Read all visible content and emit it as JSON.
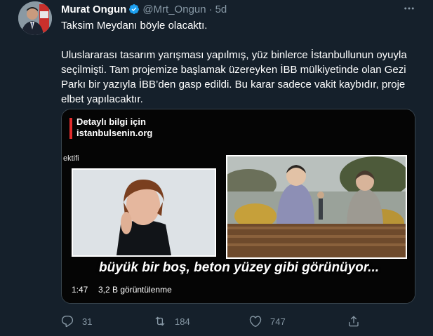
{
  "tweet": {
    "author_name": "Murat Ongun",
    "handle": "@Mrt_Ongun",
    "separator": "·",
    "time": "5d",
    "more_icon": "ellipsis-icon",
    "verified_icon": "verified-badge-icon",
    "paragraph1": "Taksim Meydanı böyle olacaktı.",
    "paragraph2": "Uluslararası tasarım yarışması yapılmış, yüz binlerce İstanbullunun oyuyla seçilmişti. Tam projemize başlamak üzereyken İBB mülkiyetinde olan Gezi Parkı bir yazıyla İBB’den gasp edildi. Bu karar sadece vakit kaybıdır, proje elbet yapılacaktır."
  },
  "media": {
    "overlay_line1": "Detaylı bilgi için",
    "overlay_line2": "istanbulsenin.org",
    "cut_label": "ektifi",
    "subtitle": "büyük bir boş, beton yüzey gibi görünüyor...",
    "duration": "1:47",
    "views": "3,2 B görüntülenme",
    "brand_color": "#e02c2c"
  },
  "actions": {
    "reply_count": "31",
    "retweet_count": "184",
    "like_count": "747",
    "icons": [
      "reply-icon",
      "retweet-icon",
      "like-icon",
      "share-icon"
    ]
  },
  "colors": {
    "background": "#15202b",
    "secondary_text": "#8899a6",
    "verified": "#1da1f2"
  }
}
